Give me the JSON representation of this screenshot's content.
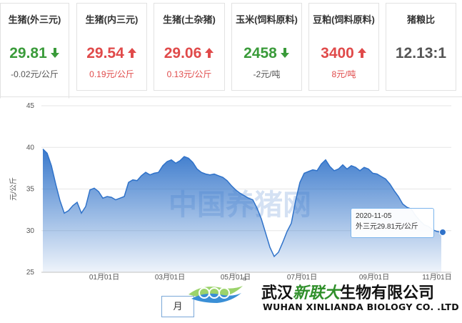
{
  "cards": [
    {
      "name": "生猪(外三元)",
      "price": "29.81",
      "delta": "-0.02元/公斤",
      "direction": "down",
      "active": true
    },
    {
      "name": "生猪(内三元)",
      "price": "29.54",
      "delta": "0.19元/公斤",
      "direction": "up",
      "active": false
    },
    {
      "name": "生猪(土杂猪)",
      "price": "29.06",
      "delta": "0.13元/公斤",
      "direction": "up",
      "active": false
    },
    {
      "name": "玉米(饲料原料)",
      "price": "2458",
      "delta": "-2元/吨",
      "direction": "down",
      "active": false
    },
    {
      "name": "豆粕(饲料原料)",
      "price": "3400",
      "delta": "8元/吨",
      "direction": "up",
      "active": false
    },
    {
      "name": "猪粮比",
      "price": "12.13:1",
      "delta": "",
      "direction": "none",
      "active": false
    }
  ],
  "colors": {
    "up": "#e04a4a",
    "down": "#3a9b3a",
    "neutral": "#555555",
    "series": "#2f72c9",
    "border": "#e2e2e2"
  },
  "chart_data": {
    "type": "area",
    "title": "",
    "xlabel": "",
    "ylabel": "元/公斤",
    "ylim": [
      25,
      45
    ],
    "yticks": [
      25,
      30,
      35,
      40,
      45
    ],
    "xticks": [
      "01月01日",
      "03月01日",
      "05月01日",
      "07月01日",
      "09月01日",
      "11月01日"
    ],
    "x_start": "2019-11-10",
    "x_end": "2020-11-05",
    "watermark": "中国养猪网",
    "grid": "horizontal",
    "series": [
      {
        "values": [
          39.8,
          39.3,
          37.8,
          35.6,
          33.6,
          32.1,
          32.4,
          33.0,
          33.4,
          32.1,
          32.9,
          34.9,
          35.1,
          34.7,
          33.9,
          34.1,
          34.0,
          33.7,
          33.9,
          34.1,
          35.8,
          36.1,
          36.0,
          36.6,
          37.0,
          36.7,
          36.9,
          37.0,
          37.8,
          38.3,
          38.5,
          38.1,
          38.4,
          38.9,
          38.7,
          38.2,
          37.4,
          37.0,
          36.8,
          36.7,
          36.8,
          36.6,
          36.4,
          36.0,
          35.4,
          34.9,
          34.5,
          34.2,
          33.9,
          33.7,
          32.7,
          31.4,
          29.7,
          28.0,
          26.9,
          27.4,
          28.6,
          29.9,
          30.9,
          33.6,
          35.8,
          36.9,
          37.1,
          37.3,
          37.2,
          38.0,
          38.5,
          37.7,
          37.2,
          37.4,
          37.9,
          37.4,
          37.8,
          37.6,
          37.2,
          37.6,
          37.4,
          36.9,
          36.8,
          36.5,
          36.2,
          35.6,
          34.8,
          34.1,
          33.2,
          32.8,
          32.6,
          31.8,
          31.2,
          30.7,
          30.5,
          30.1,
          29.9,
          29.81
        ]
      }
    ],
    "tooltip": {
      "date": "2020-11-05",
      "series_name": "外三元",
      "value": 29.81,
      "unit": "元/公斤"
    }
  },
  "tooltip_text": {
    "line1": "2020-11-05",
    "line2": "外三元29.81元/公斤"
  },
  "period_button": "月",
  "company": {
    "name_prefix": "武汉",
    "name_highlight": "新联大",
    "name_suffix": "生物有限公司",
    "name_en": "WUHAN XINLIANDA BIOLOGY CO. .LTD",
    "reg_mark": "®"
  }
}
